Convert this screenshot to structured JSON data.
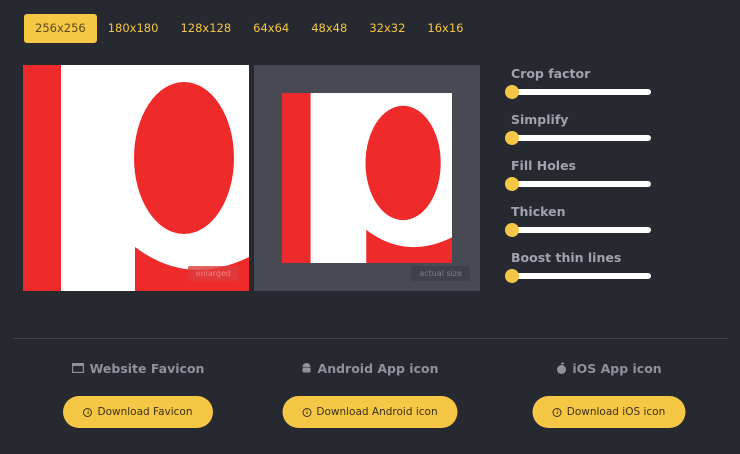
{
  "tabs": [
    "256x256",
    "180x180",
    "128x128",
    "64x64",
    "48x48",
    "32x32",
    "16x16"
  ],
  "preview": {
    "enlarged_label": "enlarged",
    "actual_label": "actual size"
  },
  "sliders": [
    {
      "label": "Crop factor",
      "value": 0
    },
    {
      "label": "Simplify",
      "value": 0
    },
    {
      "label": "Fill Holes",
      "value": 0
    },
    {
      "label": "Thicken",
      "value": 0
    },
    {
      "label": "Boost thin lines",
      "value": 0
    }
  ],
  "sections": [
    {
      "title": "Website Favicon",
      "button": "Download Favicon",
      "icon": "browser-window-icon"
    },
    {
      "title": "Android App icon",
      "button": "Download Android icon",
      "icon": "android-icon"
    },
    {
      "title": "iOS App icon",
      "button": "Download iOS icon",
      "icon": "apple-icon"
    }
  ],
  "colors": {
    "accent": "#f6c744",
    "logo_red": "#ee2a2a",
    "background": "#262930"
  }
}
